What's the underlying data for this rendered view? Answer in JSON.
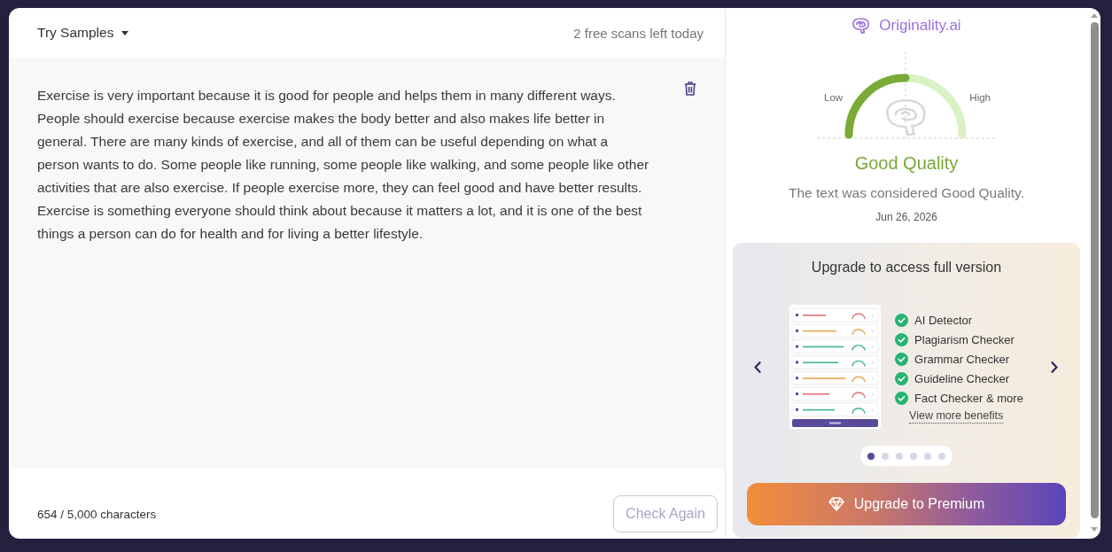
{
  "editor": {
    "samples_menu": "Try Samples",
    "scans_left": "2 free scans left today",
    "text": "Exercise is very important because it is good for people and helps them in many different ways. People should exercise because exercise makes the body better and also makes life better in general. There are many kinds of exercise, and all of them can be useful depending on what a person wants to do. Some people like running, some people like walking, and some people like other activities that are also exercise. If people exercise more, they can feel good and have better results. Exercise is something everyone should think about because it matters a lot, and it is one of the best things a person can do for health and for living a better lifestyle.",
    "char_count": "654 / 5,000 characters",
    "check_button": {
      "label": "Check Again",
      "disabled": true
    }
  },
  "result": {
    "brand": "Originality.ai",
    "gauge": {
      "low_label": "Low",
      "high_label": "High",
      "level": 0.5
    },
    "verdict": "Good Quality",
    "summary": "The text was considered Good Quality.",
    "date": "Jun 26, 2026"
  },
  "upgrade": {
    "title": "Upgrade to access full version",
    "features": [
      "AI Detector",
      "Plagiarism Checker",
      "Grammar Checker",
      "Guideline Checker",
      "Fact Checker & more"
    ],
    "link": "View more benefits",
    "slides": [
      {
        "selected": true
      },
      {
        "selected": false
      },
      {
        "selected": false
      },
      {
        "selected": false
      },
      {
        "selected": false
      },
      {
        "selected": false
      }
    ],
    "button": "Upgrade to Premium"
  }
}
